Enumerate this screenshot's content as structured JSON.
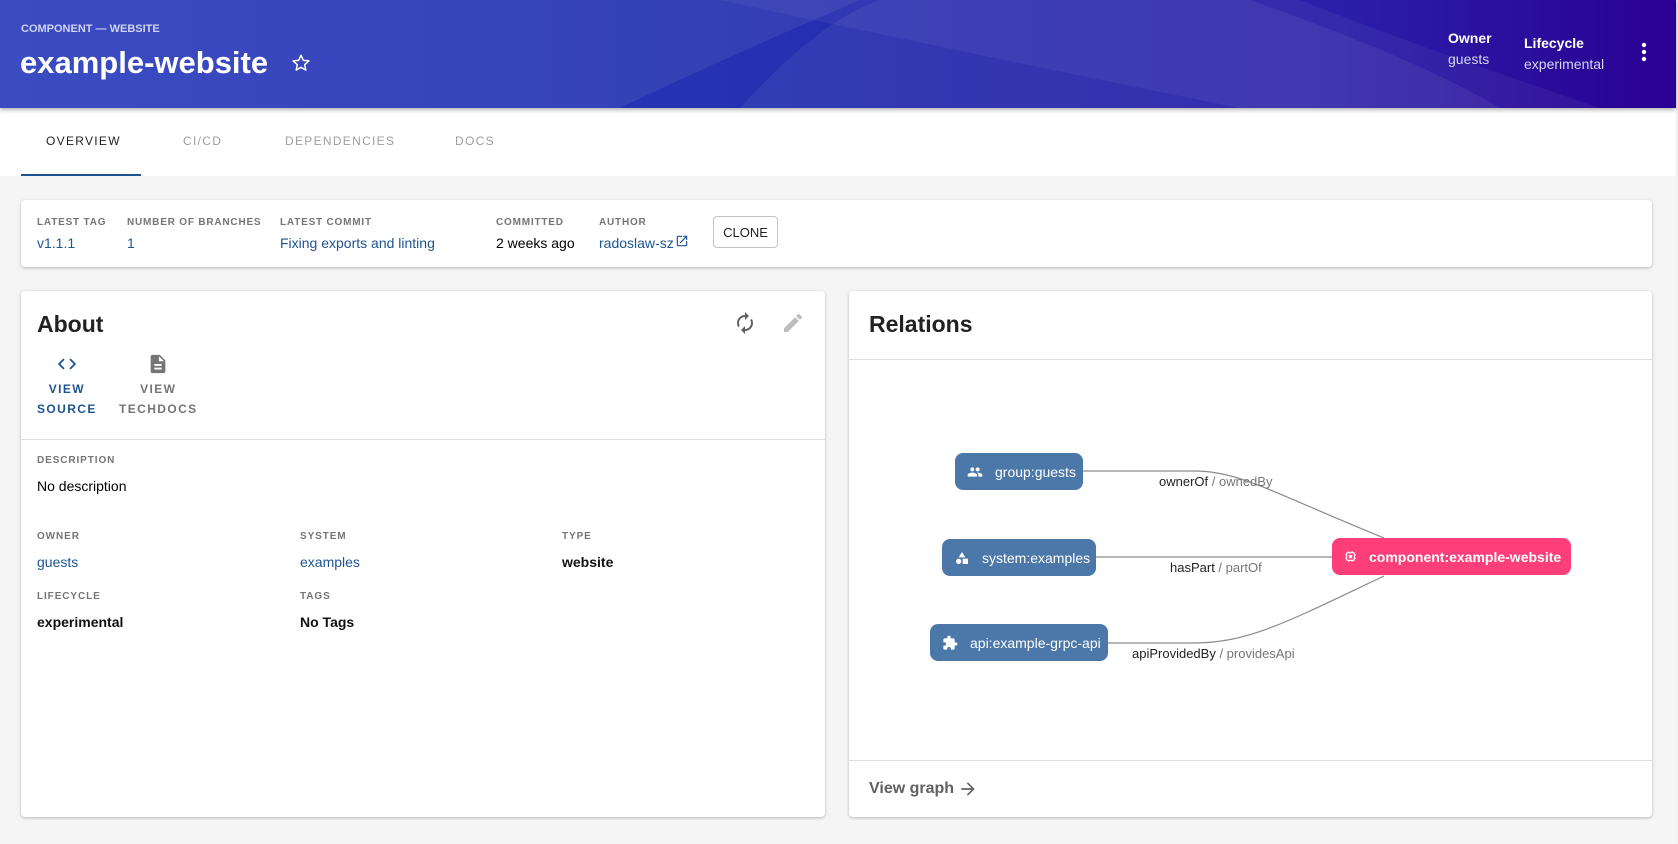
{
  "header": {
    "kind": "COMPONENT — WEBSITE",
    "title": "example-website",
    "star_icon": "star-outline-icon",
    "owner_label": "Owner",
    "owner_value": "guests",
    "lifecycle_label": "Lifecycle",
    "lifecycle_value": "experimental",
    "menu_icon": "kebab-menu-icon"
  },
  "tabs": [
    {
      "label": "OVERVIEW",
      "active": true
    },
    {
      "label": "CI/CD",
      "active": false
    },
    {
      "label": "DEPENDENCIES",
      "active": false
    },
    {
      "label": "DOCS",
      "active": false
    }
  ],
  "info": {
    "latest_tag": {
      "label": "LATEST TAG",
      "value": "v1.1.1"
    },
    "branches": {
      "label": "NUMBER OF BRANCHES",
      "value": "1"
    },
    "latest_commit": {
      "label": "LATEST COMMIT",
      "value": "Fixing exports and linting"
    },
    "committed": {
      "label": "COMMITTED",
      "value": "2 weeks ago"
    },
    "author": {
      "label": "AUTHOR",
      "value": "radoslaw-sz",
      "icon": "external-link-icon"
    },
    "clone_label": "CLONE"
  },
  "about": {
    "title": "About",
    "refresh_icon": "refresh-icon",
    "edit_icon": "edit-icon",
    "view_source": {
      "line1": "VIEW",
      "line2": "SOURCE",
      "icon": "code-icon"
    },
    "view_techdocs": {
      "line1": "VIEW",
      "line2": "TECHDOCS",
      "icon": "document-icon"
    },
    "description": {
      "label": "DESCRIPTION",
      "value": "No description"
    },
    "owner": {
      "label": "OWNER",
      "value": "guests"
    },
    "system": {
      "label": "SYSTEM",
      "value": "examples"
    },
    "type": {
      "label": "TYPE",
      "value": "website"
    },
    "lifecycle": {
      "label": "LIFECYCLE",
      "value": "experimental"
    },
    "tags": {
      "label": "TAGS",
      "value": "No Tags"
    }
  },
  "relations": {
    "title": "Relations",
    "view_graph": "View graph",
    "nodes": [
      {
        "id": "group",
        "label": "group:guests",
        "icon": "group-icon",
        "color": "#4b77a9"
      },
      {
        "id": "system",
        "label": "system:examples",
        "icon": "system-icon",
        "color": "#4b77a9"
      },
      {
        "id": "api",
        "label": "api:example-grpc-api",
        "icon": "api-puzzle-icon",
        "color": "#4b77a9"
      },
      {
        "id": "component",
        "label": "component:example-website",
        "icon": "component-chip-icon",
        "color": "#fc3e7b"
      }
    ],
    "edges": [
      {
        "from": "group",
        "to": "component",
        "relation": "ownerOf",
        "reverse": " / ownedBy"
      },
      {
        "from": "system",
        "to": "component",
        "relation": "hasPart",
        "reverse": " / partOf"
      },
      {
        "from": "api",
        "to": "component",
        "relation": "apiProvidedBy",
        "reverse": " / providesApi"
      }
    ]
  },
  "colors": {
    "link": "#1f5493",
    "header_start": "#2d3fbe",
    "header_end": "#2a0092",
    "node_blue": "#4b77a9",
    "node_pink": "#fc3e7b"
  }
}
